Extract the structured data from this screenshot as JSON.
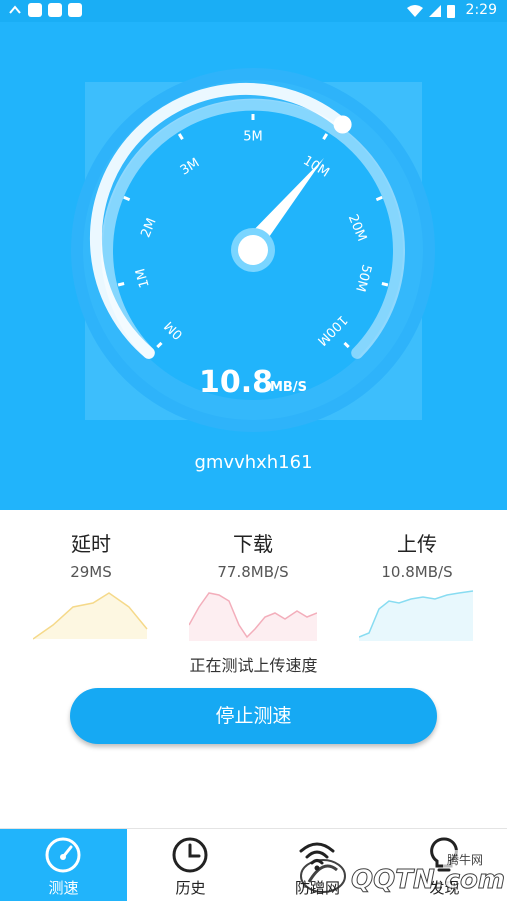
{
  "status_bar": {
    "time": "2:29"
  },
  "gauge": {
    "ticks": [
      "0M",
      "1M",
      "2M",
      "3M",
      "5M",
      "10M",
      "20M",
      "50M",
      "100M"
    ],
    "speed_value": "10.8",
    "speed_unit": "MB/S"
  },
  "network_name": "gmvvhxh161",
  "stats": [
    {
      "title": "延时",
      "value": "29MS",
      "color": "#f5e6a8"
    },
    {
      "title": "下载",
      "value": "77.8MB/S",
      "color": "#f3b9c3"
    },
    {
      "title": "上传",
      "value": "10.8MB/S",
      "color": "#9fe3f3"
    }
  ],
  "status_text": "正在测试上传速度",
  "stop_button": "停止测速",
  "tabs": [
    {
      "label": "测速",
      "icon": "speedometer-icon",
      "active": true
    },
    {
      "label": "历史",
      "icon": "clock-icon",
      "active": false
    },
    {
      "label": "防蹭网",
      "icon": "wifi-icon",
      "active": false
    },
    {
      "label": "发现",
      "icon": "lightbulb-icon",
      "active": false
    }
  ],
  "watermark": {
    "site": "腾牛网",
    "brand": "QQTN.com"
  }
}
